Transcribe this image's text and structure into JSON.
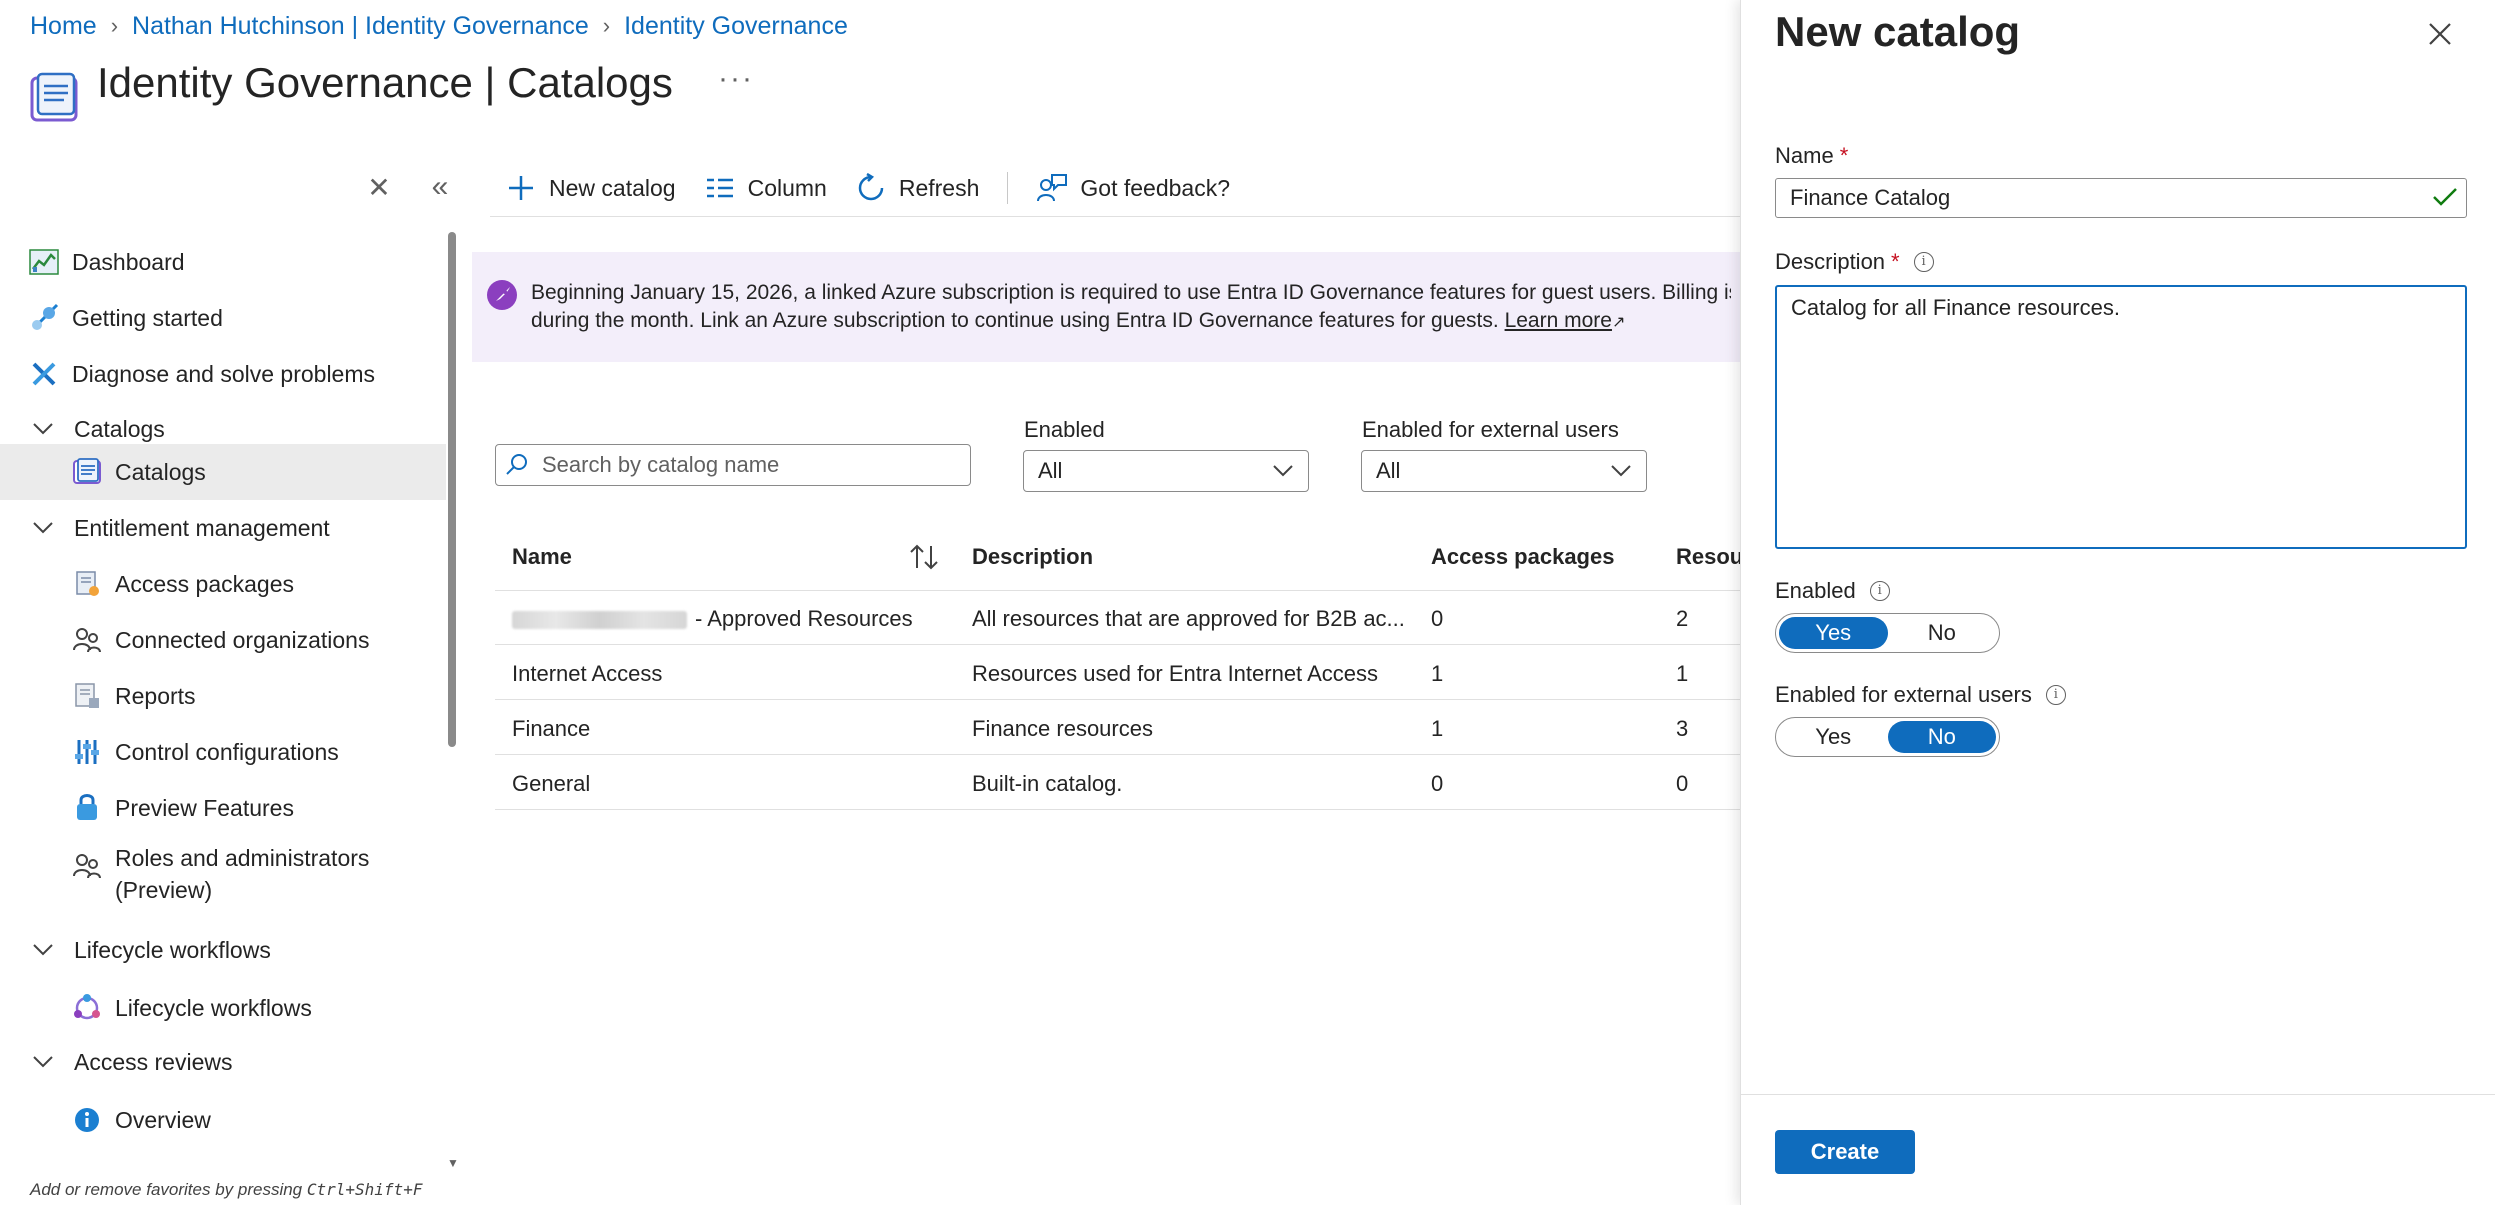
{
  "breadcrumb": [
    "Home",
    "Nathan Hutchinson | Identity Governance",
    "Identity Governance"
  ],
  "page": {
    "title": "Identity Governance | Catalogs",
    "more": "···"
  },
  "sidebar": {
    "items": [
      {
        "label": "Dashboard",
        "icon": "dashboard-icon"
      },
      {
        "label": "Getting started",
        "icon": "rocket-icon"
      },
      {
        "label": "Diagnose and solve problems",
        "icon": "wrench-icon"
      },
      {
        "label": "Catalogs",
        "icon": "chevron-down-icon"
      },
      {
        "label": "Catalogs",
        "icon": "catalog-icon"
      },
      {
        "label": "Entitlement management",
        "icon": "chevron-down-icon"
      },
      {
        "label": "Access packages",
        "icon": "access-package-icon"
      },
      {
        "label": "Connected organizations",
        "icon": "people-icon"
      },
      {
        "label": "Reports",
        "icon": "report-icon"
      },
      {
        "label": "Control configurations",
        "icon": "sliders-icon"
      },
      {
        "label": "Preview Features",
        "icon": "flask-icon"
      },
      {
        "label": "Roles and administrators",
        "label2": "(Preview)",
        "icon": "people-icon"
      },
      {
        "label": "Lifecycle workflows",
        "icon": "chevron-down-icon"
      },
      {
        "label": "Lifecycle workflows",
        "icon": "workflow-icon"
      },
      {
        "label": "Access reviews",
        "icon": "chevron-down-icon"
      },
      {
        "label": "Overview",
        "icon": "info-icon"
      }
    ],
    "fav_hint_prefix": "Add or remove favorites by pressing",
    "fav_hint_keys": "Ctrl+Shift+F"
  },
  "toolbar": {
    "new_catalog": "New catalog",
    "column": "Column",
    "refresh": "Refresh",
    "feedback": "Got feedback?"
  },
  "banner": {
    "line1": "Beginning January 15, 2026, a linked Azure subscription is required to use Entra ID Governance features for guest users. Billing is ba",
    "line2": "during the month. Link an Azure subscription to continue using Entra ID Governance features for guests.",
    "link": "Learn more"
  },
  "filters": {
    "search_placeholder": "Search by catalog name",
    "enabled_label": "Enabled",
    "enabled_value": "All",
    "external_label": "Enabled for external users",
    "external_value": "All"
  },
  "table": {
    "headers": [
      "Name",
      "Description",
      "Access packages",
      "Resou"
    ],
    "rows": [
      {
        "name": "- Approved Resources",
        "desc": "All resources that are approved for B2B ac...",
        "packages": "0",
        "resources": "2"
      },
      {
        "name": "Internet Access",
        "desc": "Resources used for Entra Internet Access",
        "packages": "1",
        "resources": "1"
      },
      {
        "name": "Finance",
        "desc": "Finance resources",
        "packages": "1",
        "resources": "3"
      },
      {
        "name": "General",
        "desc": "Built-in catalog.",
        "packages": "0",
        "resources": "0"
      }
    ]
  },
  "panel": {
    "title": "New catalog",
    "name_label": "Name",
    "name_value": "Finance Catalog",
    "desc_label": "Description",
    "desc_value": "Catalog for all Finance resources.",
    "enabled_label": "Enabled",
    "enabled_yes": "Yes",
    "enabled_no": "No",
    "enabled_selected": "Yes",
    "external_label": "Enabled for external users",
    "external_yes": "Yes",
    "external_no": "No",
    "external_selected": "No",
    "required_mark": "*",
    "create": "Create"
  },
  "colors": {
    "accent": "#0f6cbd",
    "banner_bg": "#f3eefa",
    "banner_icon": "#8b3fbf",
    "required": "#c50f1f",
    "valid": "#107c10"
  }
}
